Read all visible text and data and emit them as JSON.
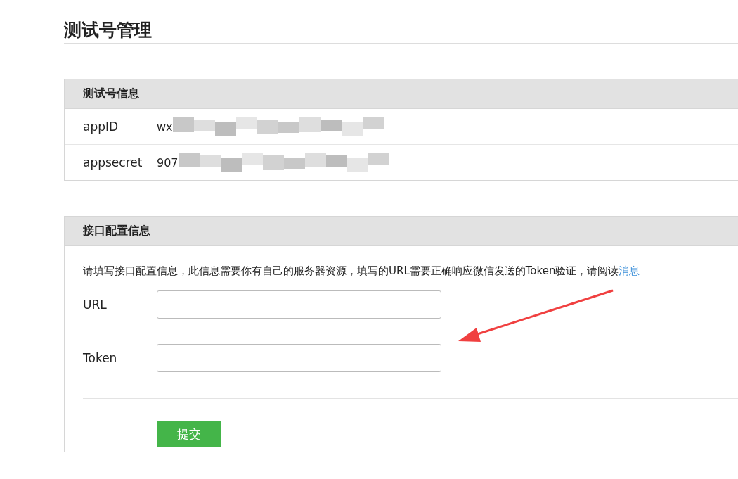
{
  "page_title": "测试号管理",
  "test_account": {
    "title": "测试号信息",
    "fields": [
      {
        "label": "appID",
        "value_visible": "wx"
      },
      {
        "label": "appsecret",
        "value_visible": "907"
      }
    ]
  },
  "interface_config": {
    "title": "接口配置信息",
    "description": "请填写接口配置信息，此信息需要你有自己的服务器资源，填写的URL需要正确响应微信发送的Token验证，请阅读",
    "description_link": "消息",
    "inputs": [
      {
        "label": "URL"
      },
      {
        "label": "Token"
      }
    ],
    "submit_button": "提交"
  }
}
